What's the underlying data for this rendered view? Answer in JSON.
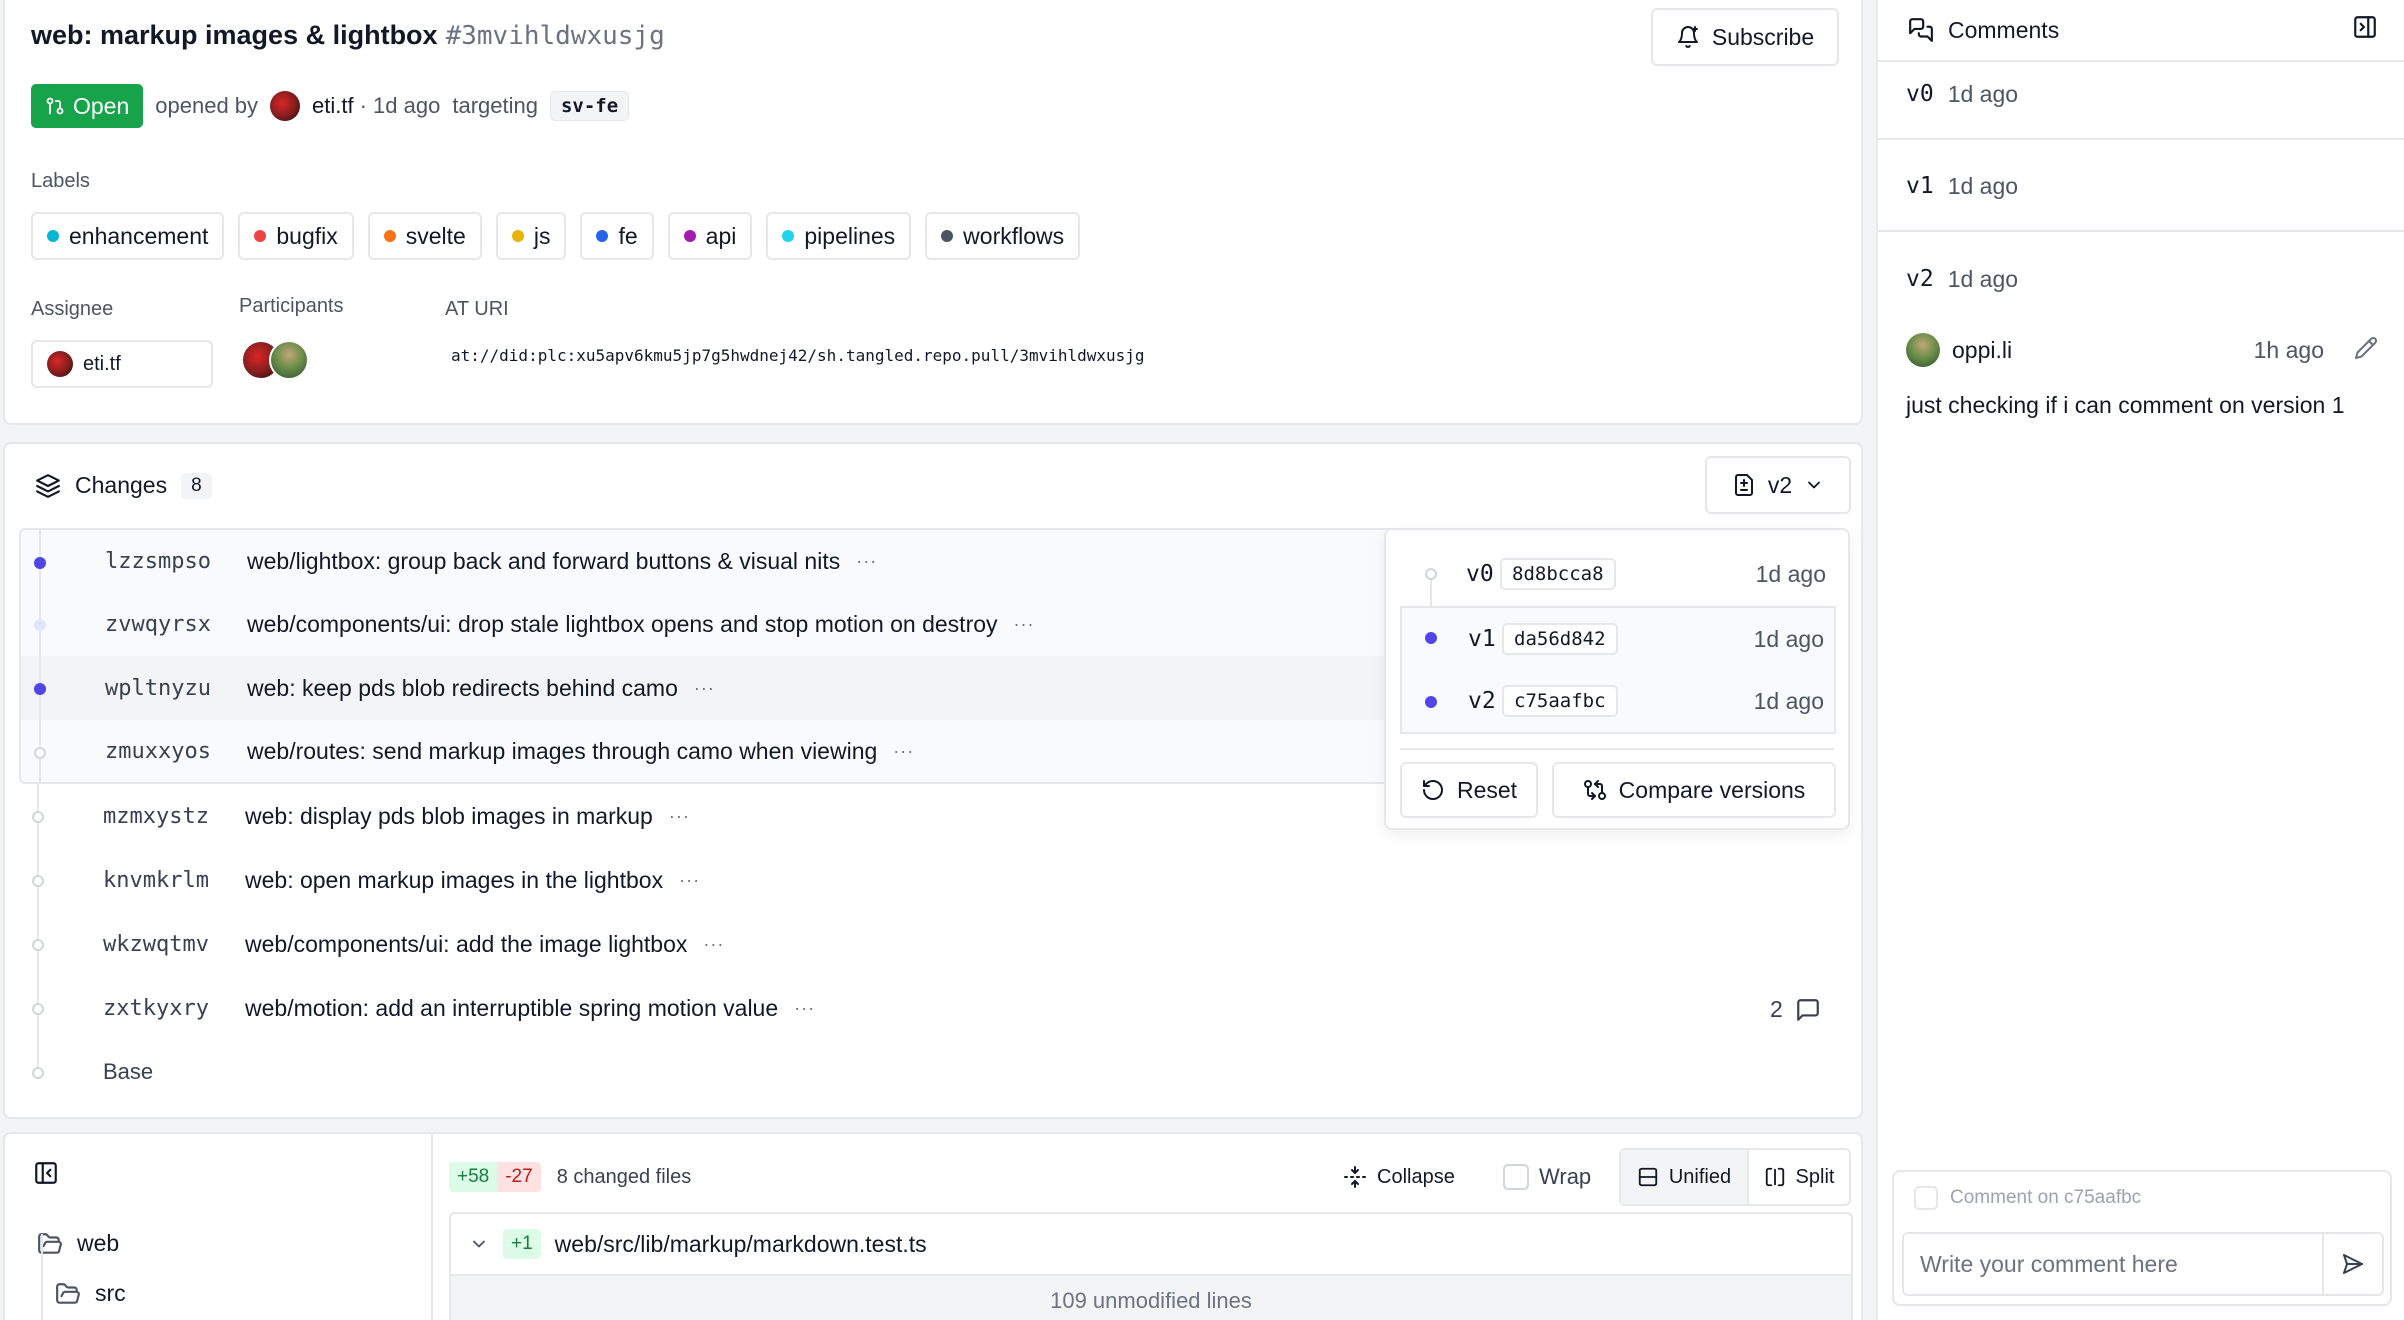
{
  "pr": {
    "title": "web: markup images & lightbox",
    "id": "#3mvihldwxusjg",
    "subscribe_label": "Subscribe",
    "status": "Open",
    "opened_by_prefix": "opened by",
    "author": "eti.tf",
    "age": "· 1d ago",
    "targeting_label": "targeting",
    "target_branch": "sv-fe"
  },
  "labels_section": {
    "title": "Labels",
    "items": [
      {
        "name": "enhancement",
        "color": "#06b6d4"
      },
      {
        "name": "bugfix",
        "color": "#ef4444"
      },
      {
        "name": "svelte",
        "color": "#f97316"
      },
      {
        "name": "js",
        "color": "#eab308"
      },
      {
        "name": "fe",
        "color": "#2563eb"
      },
      {
        "name": "api",
        "color": "#a21caf"
      },
      {
        "name": "pipelines",
        "color": "#22d3ee"
      },
      {
        "name": "workflows",
        "color": "#4b5563"
      }
    ]
  },
  "assignee": {
    "title": "Assignee",
    "name": "eti.tf"
  },
  "participants": {
    "title": "Participants"
  },
  "at_uri": {
    "title": "AT URI",
    "value": "at://did:plc:xu5apv6kmu5jp7g5hwdnej42/sh.tangled.repo.pull/3mvihldwxusjg"
  },
  "changes": {
    "title": "Changes",
    "count": "8",
    "selected_version": "v2",
    "commits": [
      {
        "change_id": "lzzsmpso",
        "message": "web/lightbox: group back and forward buttons & visual nits"
      },
      {
        "change_id": "zvwqyrsx",
        "message": "web/components/ui: drop stale lightbox opens and stop motion on destroy"
      },
      {
        "change_id": "wpltnyzu",
        "message": "web: keep pds blob redirects behind camo"
      },
      {
        "change_id": "zmuxxyos",
        "message": "web/routes: send markup images through camo when viewing"
      },
      {
        "change_id": "mzmxystz",
        "message": "web: display pds blob images in markup"
      },
      {
        "change_id": "knvmkrlm",
        "message": "web: open markup images in the lightbox"
      },
      {
        "change_id": "wkzwqtmv",
        "message": "web/components/ui: add the image lightbox"
      },
      {
        "change_id": "zxtkyxry",
        "message": "web/motion: add an interruptible spring motion value"
      }
    ],
    "base_label": "Base",
    "more_glyph": "···",
    "comment_count": "2"
  },
  "version_popover": {
    "versions": [
      {
        "name": "v0",
        "hash": "8d8bcca8",
        "time": "1d ago"
      },
      {
        "name": "v1",
        "hash": "da56d842",
        "time": "1d ago"
      },
      {
        "name": "v2",
        "hash": "c75aafbc",
        "time": "1d ago"
      }
    ],
    "reset_label": "Reset",
    "compare_label": "Compare versions"
  },
  "diff": {
    "additions": "+58",
    "deletions": "-27",
    "changed_files": "8 changed files",
    "collapse_label": "Collapse",
    "wrap_label": "Wrap",
    "unified_label": "Unified",
    "split_label": "Split",
    "tree": [
      {
        "name": "web"
      },
      {
        "name": "src"
      }
    ],
    "file": {
      "additions": "+1",
      "path": "web/src/lib/markup/markdown.test.ts",
      "unmodified": "109 unmodified lines"
    }
  },
  "sidebar": {
    "title": "Comments",
    "versions": [
      {
        "name": "v0",
        "time": "1d ago"
      },
      {
        "name": "v1",
        "time": "1d ago"
      },
      {
        "name": "v2",
        "time": "1d ago"
      }
    ],
    "comment": {
      "author": "oppi.li",
      "time": "1h ago",
      "body": "just checking if i can comment on version 1"
    },
    "composer": {
      "option_label": "Comment on c75aafbc",
      "placeholder": "Write your comment here"
    }
  }
}
